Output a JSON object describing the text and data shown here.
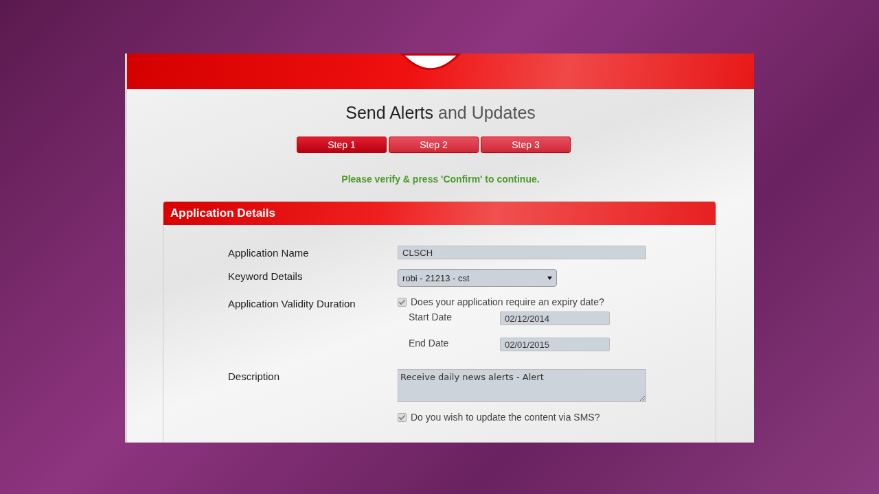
{
  "page": {
    "title_main": "Send Alerts",
    "title_rest": "and Updates"
  },
  "steps": [
    {
      "label": "Step 1",
      "selected": true
    },
    {
      "label": "Step 2",
      "selected": false
    },
    {
      "label": "Step 3",
      "selected": false
    }
  ],
  "message": "Please verify & press 'Confirm' to continue.",
  "panel": {
    "title": "Application Details",
    "fields": [
      {
        "kind": "text",
        "label": "Application Name",
        "value": "CLSCH"
      },
      {
        "kind": "select",
        "label": "Keyword Details",
        "value": "robi - 21213 - cst"
      },
      {
        "kind": "validity",
        "label": "Application Validity Duration",
        "checkbox": {
          "label": "Does your application require an expiry date?",
          "checked": true
        },
        "dates": [
          {
            "label": "Start Date",
            "value": "02/12/2014"
          },
          {
            "label": "End Date",
            "value": "02/01/2015"
          }
        ]
      },
      {
        "kind": "textarea",
        "label": "Description",
        "value": "Receive daily news alerts - Alert"
      },
      {
        "kind": "check",
        "checkbox": {
          "label": "Do you wish to update the content via SMS?",
          "checked": true
        }
      }
    ]
  }
}
